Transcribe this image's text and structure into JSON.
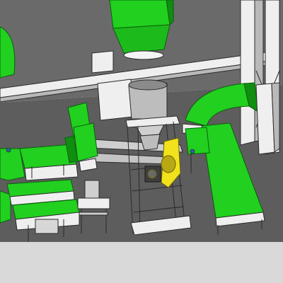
{
  "scene": {
    "colors": {
      "background": "#d8d8d8",
      "floor": "#5d5d5d",
      "frame": "#efefef",
      "frame_shade": "#b9b9b9",
      "outline": "#2b2b2b",
      "green": "#22d11f",
      "green_dark": "#0f8e10",
      "yellow": "#f1e21c",
      "steel": "#bdbdbd",
      "steel_dark": "#8b8b8b",
      "blue": "#3a58b8"
    },
    "components": [
      {
        "name": "hopper-funnel",
        "color": "green"
      },
      {
        "name": "roller-conveyor-left-upper",
        "color": "green"
      },
      {
        "name": "roller-conveyor-left-middle",
        "color": "green"
      },
      {
        "name": "roller-conveyor-left-lower",
        "color": "green"
      },
      {
        "name": "curved-belt-conveyor",
        "color": "green"
      },
      {
        "name": "straight-belt-conveyor-right",
        "color": "green"
      },
      {
        "name": "bag-filling-tower",
        "color": "steel"
      },
      {
        "name": "screw-feeder-tubes",
        "color": "steel"
      },
      {
        "name": "drive-motor",
        "color": "yellow"
      }
    ]
  }
}
